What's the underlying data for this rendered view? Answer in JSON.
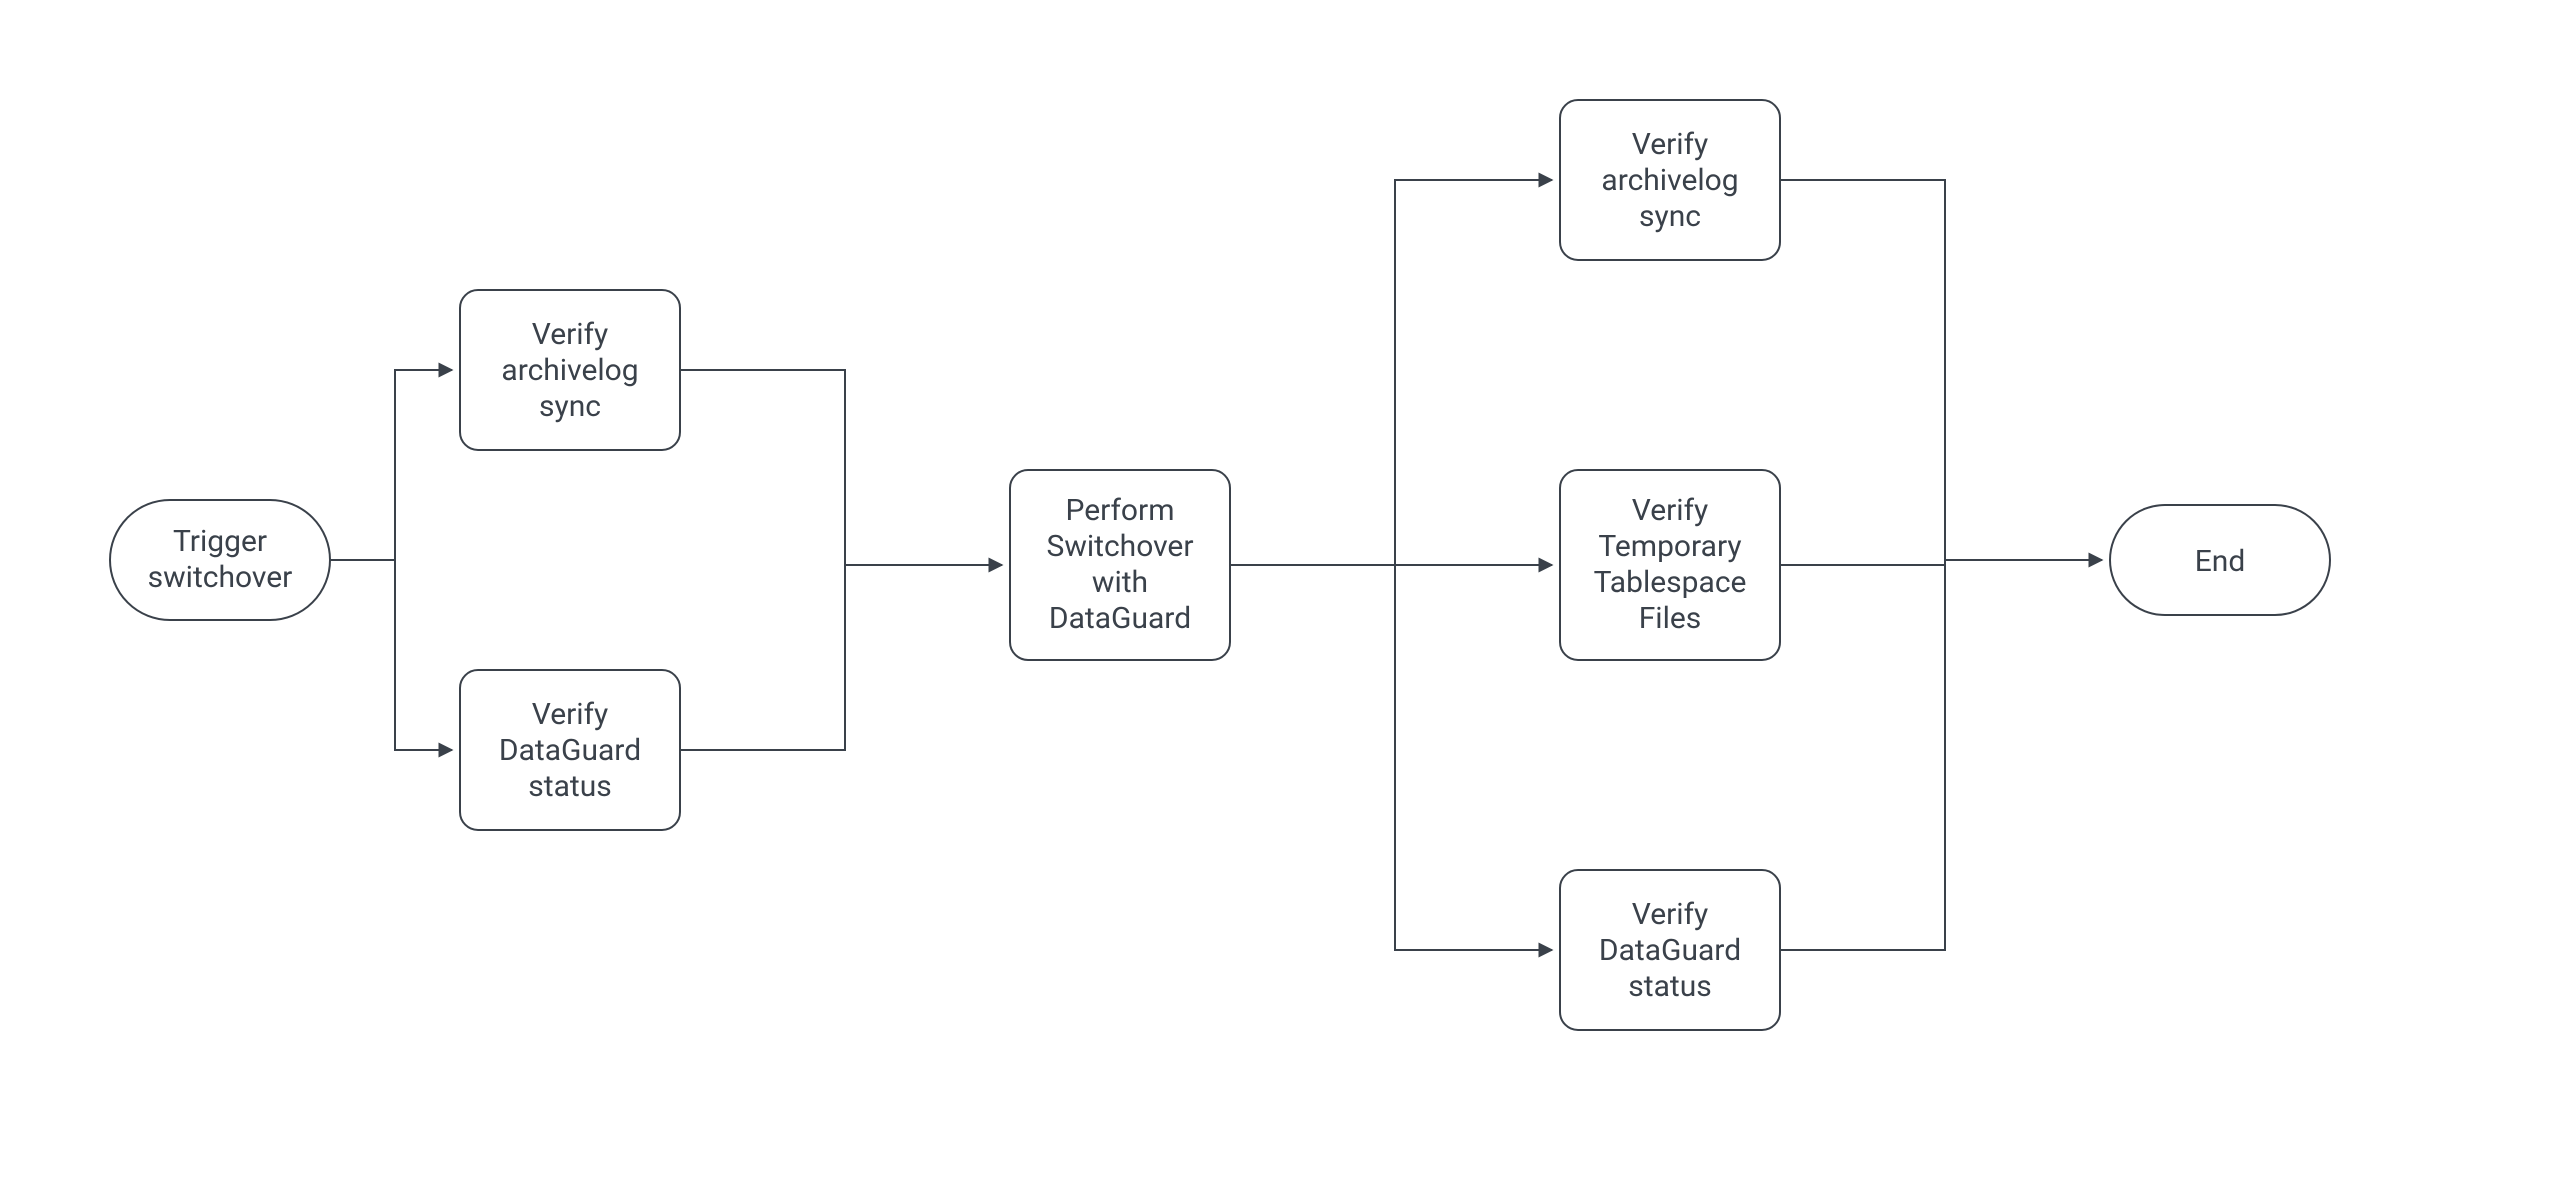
{
  "diagram": {
    "nodes": {
      "start": {
        "line1": "Trigger",
        "line2": "switchover"
      },
      "preVerifyArchivelog": {
        "line1": "Verify",
        "line2": "archivelog",
        "line3": "sync"
      },
      "preVerifyDataGuard": {
        "line1": "Verify",
        "line2": "DataGuard",
        "line3": "status"
      },
      "performSwitchover": {
        "line1": "Perform",
        "line2": "Switchover",
        "line3": "with",
        "line4": "DataGuard"
      },
      "postVerifyArchivelog": {
        "line1": "Verify",
        "line2": "archivelog",
        "line3": "sync"
      },
      "postVerifyTempTablespace": {
        "line1": "Verify",
        "line2": "Temporary",
        "line3": "Tablespace",
        "line4": "Files"
      },
      "postVerifyDataGuard": {
        "line1": "Verify",
        "line2": "DataGuard",
        "line3": "status"
      },
      "end": {
        "line1": "End"
      }
    }
  }
}
